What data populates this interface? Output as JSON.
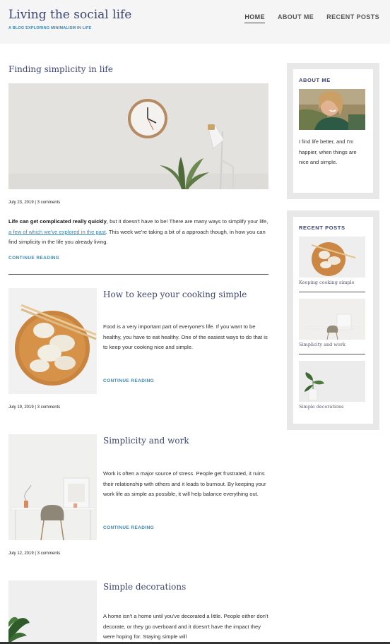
{
  "header": {
    "site_title": "Living the social life",
    "tagline": "A BLOG EXPLORING MINIMALISM IN LIFE",
    "nav": [
      {
        "label": "HOME",
        "active": true
      },
      {
        "label": "ABOUT ME",
        "active": false
      },
      {
        "label": "RECENT POSTS",
        "active": false
      }
    ]
  },
  "feature": {
    "title": "Finding simplicity in life",
    "image": "clock-and-lamp-photo",
    "meta": "July 23, 2019 | 3 comments",
    "text_bold": "Life can get complicated really quickly",
    "text_1": ", but it doesn't have to be! There are many ways to simplify your life, ",
    "link_text": "a few of which we've explored in the past",
    "text_2": ". This week we're taking a bit of a approach though, in how you can find simplicity in the life you already living.",
    "read_more": "CONTINUE READING"
  },
  "posts": [
    {
      "title": "How to keep your cooking simple",
      "image": "dumplings-photo",
      "text": "Food is a very important part of everyone's life. If you want to be healthy, you have to eat healthy. One of the easiest ways to do that is to keep your cooking nice and simple.",
      "read_more": "CONTINUE READING",
      "meta": "July 19, 2019 | 3 comments"
    },
    {
      "title": "Simplicity and work",
      "image": "desk-chair-photo",
      "text": "Work is often a major source of stress. People get frustrated, it ruins their relationship with others and it leads to burnout. By keeping your work life as simple as possible, it will help balance everything out.",
      "read_more": "CONTINUE READING",
      "meta": "July 12, 2019 | 3 comments"
    },
    {
      "title": "Simple decorations",
      "image": "plant-photo",
      "text": "A home isn't a home until you've decorated a little. People either don't decorate, or they go overboard and it doesn't have the impact they were hoping for. Staying simple will"
    }
  ],
  "sidebar": {
    "about": {
      "title": "ABOUT ME",
      "image": "smiling-person-photo",
      "text": "I find life better, and I'm happier, when things are nice and simple."
    },
    "recent": {
      "title": "RECENT POSTS",
      "items": [
        {
          "caption": "Keeping cooking simple",
          "image": "dumplings-thumb"
        },
        {
          "caption": "Simplicity and work",
          "image": "desk-thumb"
        },
        {
          "caption": "Simple decorations",
          "image": "plant-thumb"
        }
      ]
    }
  }
}
